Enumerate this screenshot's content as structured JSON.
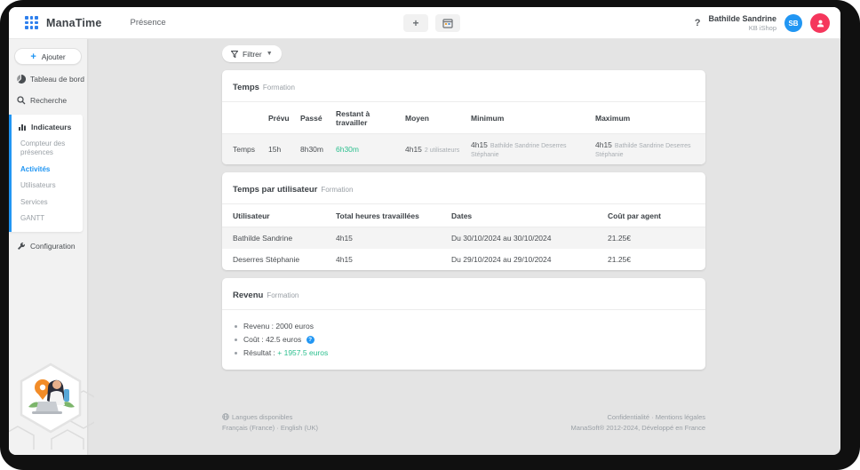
{
  "topbar": {
    "brand": "ManaTime",
    "nav_presence": "Présence",
    "add_label": "+",
    "help_label": "?",
    "user_name": "Bathilde Sandrine",
    "user_org": "KB iShop",
    "avatar_initials": "SB"
  },
  "sidebar": {
    "add_plus": "+",
    "add_label": "Ajouter",
    "dashboard": "Tableau de bord",
    "search": "Recherche",
    "indicators": "Indicateurs",
    "sub_counter": "Compteur des présences",
    "sub_activities": "Activités",
    "sub_users": "Utilisateurs",
    "sub_services": "Services",
    "sub_gantt": "GANTT",
    "configuration": "Configuration"
  },
  "content": {
    "filter_label": "Filtrer",
    "filter_caret": "▼",
    "card_temps": {
      "title": "Temps",
      "subtitle": "Formation",
      "headers": {
        "prevu": "Prévu",
        "passe": "Passé",
        "restant": "Restant à travailler",
        "moyen": "Moyen",
        "minimum": "Minimum",
        "maximum": "Maximum"
      },
      "row": {
        "label": "Temps",
        "prevu": "15h",
        "passe": "8h30m",
        "restant": "6h30m",
        "moyen": "4h15",
        "moyen_note": "2 utilisateurs",
        "minimum": "4h15",
        "minimum_note": "Bathilde Sandrine Deserres Stéphanie",
        "maximum": "4h15",
        "maximum_note": "Bathilde Sandrine Deserres Stéphanie"
      }
    },
    "card_users": {
      "title": "Temps par utilisateur",
      "subtitle": "Formation",
      "headers": {
        "user": "Utilisateur",
        "total": "Total heures travaillées",
        "dates": "Dates",
        "cost": "Coût par agent"
      },
      "rows": [
        {
          "user": "Bathilde Sandrine",
          "total": "4h15",
          "dates": "Du 30/10/2024 au 30/10/2024",
          "cost": "21.25€"
        },
        {
          "user": "Deserres Stéphanie",
          "total": "4h15",
          "dates": "Du 29/10/2024 au 29/10/2024",
          "cost": "21.25€"
        }
      ]
    },
    "card_revenue": {
      "title": "Revenu",
      "subtitle": "Formation",
      "revenu_label": "Revenu :",
      "revenu_value": "2000 euros",
      "cout_label": "Coût :",
      "cout_value": "42.5 euros",
      "help_glyph": "?",
      "resultat_label": "Résultat :",
      "resultat_value": "+ 1957.5 euros"
    }
  },
  "footer": {
    "languages_title": "Langues disponibles",
    "lang_fr": "Français (France)",
    "separator": "·",
    "lang_en": "English (UK)",
    "legal_privacy": "Confidentialité",
    "legal_terms": "Mentions légales",
    "copyright": "ManaSoft® 2012-2024, Développé en France"
  },
  "colors": {
    "accent_blue": "#2196f3",
    "green": "#2bbf8e",
    "red": "#f5365c"
  }
}
